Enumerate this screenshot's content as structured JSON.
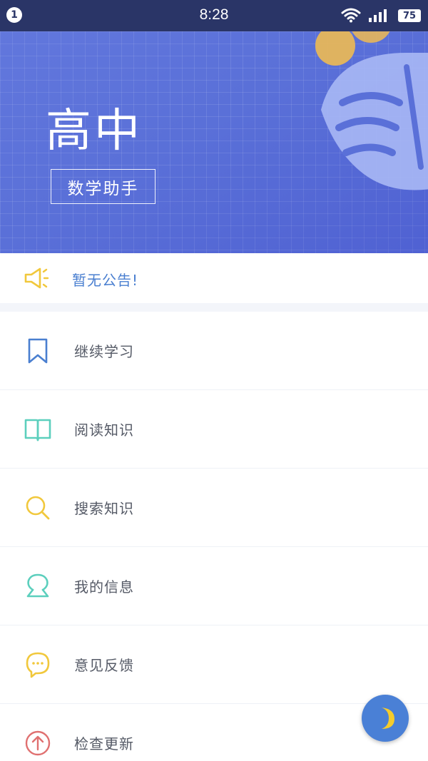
{
  "status_bar": {
    "notification_count": "1",
    "time": "8:28",
    "battery_level": "75",
    "icons": [
      "wifi-icon",
      "signal-icon",
      "battery-icon"
    ]
  },
  "banner": {
    "title": "高中",
    "subtitle": "数学助手",
    "background_color": "#5a70d8",
    "decoration": "leaf-icon"
  },
  "announcement": {
    "icon": "megaphone-icon",
    "text": "暂无公告!"
  },
  "menu": {
    "items": [
      {
        "label": "继续学习",
        "icon": "bookmark-icon",
        "color": "#4a7fd0"
      },
      {
        "label": "阅读知识",
        "icon": "book-icon",
        "color": "#5ccfbd"
      },
      {
        "label": "搜索知识",
        "icon": "search-icon",
        "color": "#f1c83c"
      },
      {
        "label": "我的信息",
        "icon": "user-icon",
        "color": "#5ccfbd"
      },
      {
        "label": "意见反馈",
        "icon": "chat-bubble-icon",
        "color": "#f1c83c"
      },
      {
        "label": "检查更新",
        "icon": "upload-arrow-icon",
        "color": "#e07070"
      }
    ]
  },
  "night_mode_button": {
    "icon": "moon-icon",
    "color": "#4a80d6"
  }
}
